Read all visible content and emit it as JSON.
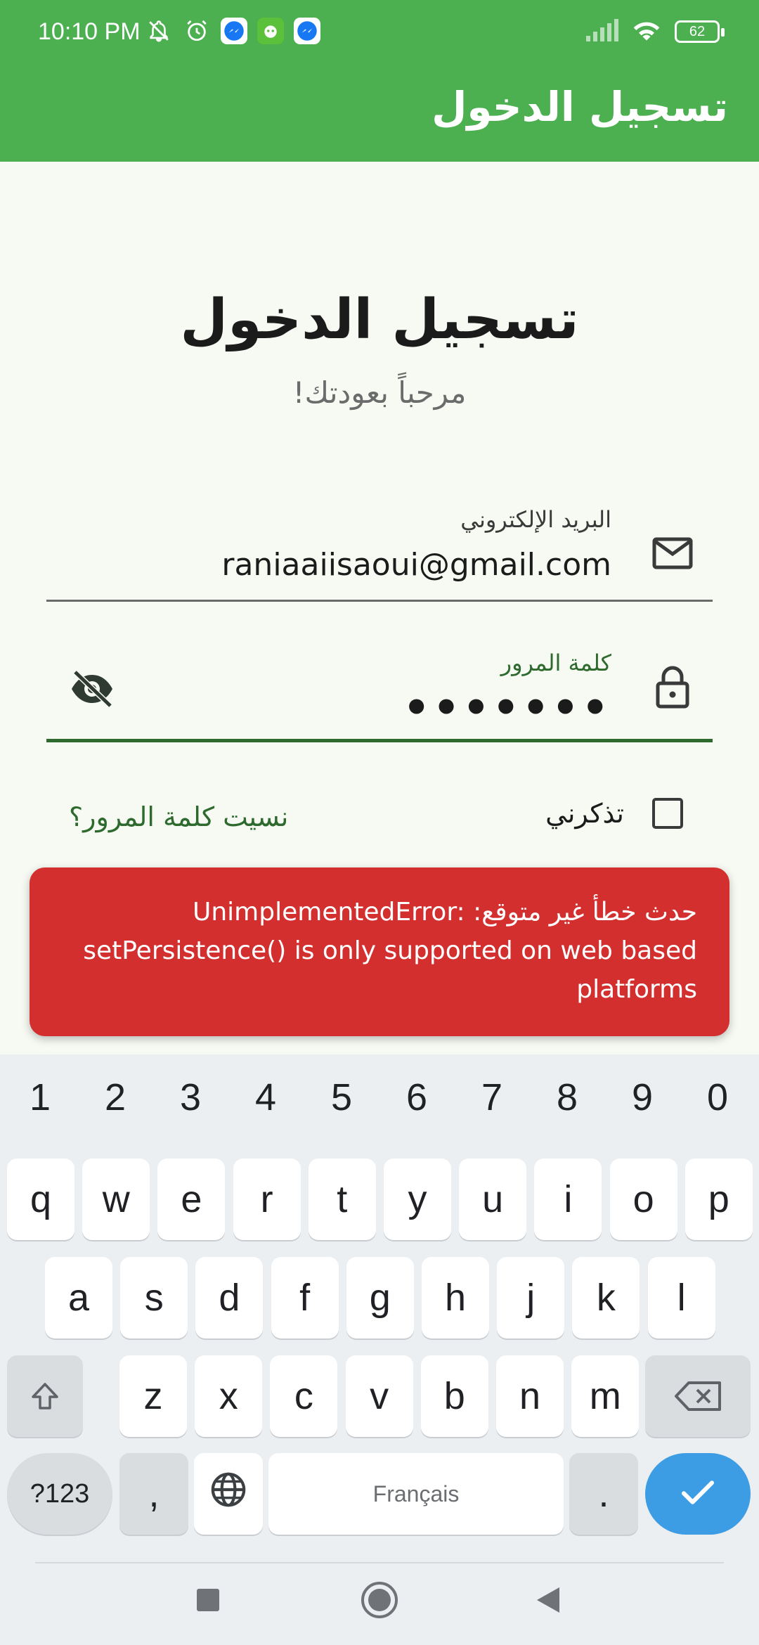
{
  "status_bar": {
    "time": "10:10 PM",
    "battery": "62",
    "icons": [
      "bell-off-icon",
      "alarm-icon",
      "messenger-icon",
      "app-icon",
      "messenger-icon",
      "signal-icon",
      "wifi-icon",
      "battery-icon"
    ]
  },
  "app_bar": {
    "title": "تسجيل الدخول"
  },
  "header": {
    "title": "تسجيل الدخول",
    "subtitle": "مرحباً بعودتك!"
  },
  "email": {
    "label": "البريد الإلكتروني",
    "value": "raniaaiisaoui@gmail.com"
  },
  "password": {
    "label": "كلمة المرور",
    "value": "•••••••"
  },
  "remember": {
    "label": "تذكرني",
    "checked": false
  },
  "forgot": {
    "label": "نسيت كلمة المرور؟"
  },
  "snackbar": {
    "text": "حدث خطأ غير متوقع: UnimplementedError: setPersistence() is only supported on web based platforms",
    "color": "#d32f2f"
  },
  "keyboard": {
    "numbers": [
      "1",
      "2",
      "3",
      "4",
      "5",
      "6",
      "7",
      "8",
      "9",
      "0"
    ],
    "row1": [
      "q",
      "w",
      "e",
      "r",
      "t",
      "y",
      "u",
      "i",
      "o",
      "p"
    ],
    "row2": [
      "a",
      "s",
      "d",
      "f",
      "g",
      "h",
      "j",
      "k",
      "l"
    ],
    "row3": [
      "z",
      "x",
      "c",
      "v",
      "b",
      "n",
      "m"
    ],
    "symbols_key": "?123",
    "comma": ",",
    "space": "Français",
    "period": ".",
    "accent": "#3d9de4"
  },
  "colors": {
    "primary": "#4caf50",
    "dark_green": "#2e6a2e",
    "background": "#f6faf2"
  }
}
